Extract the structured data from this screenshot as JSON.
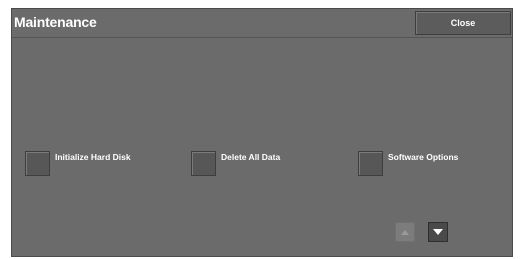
{
  "window": {
    "title": "Maintenance",
    "close_label": "Close"
  },
  "options": [
    {
      "label": "Initialize Hard Disk"
    },
    {
      "label": "Delete All Data"
    },
    {
      "label": "Software Options"
    }
  ],
  "scroll": {
    "up_icon": "triangle-up-icon",
    "up_enabled": false,
    "down_icon": "triangle-down-icon",
    "down_enabled": true
  },
  "colors": {
    "panel_bg": "#6b6b6b",
    "button_bg": "#575757",
    "text": "#ffffff"
  }
}
